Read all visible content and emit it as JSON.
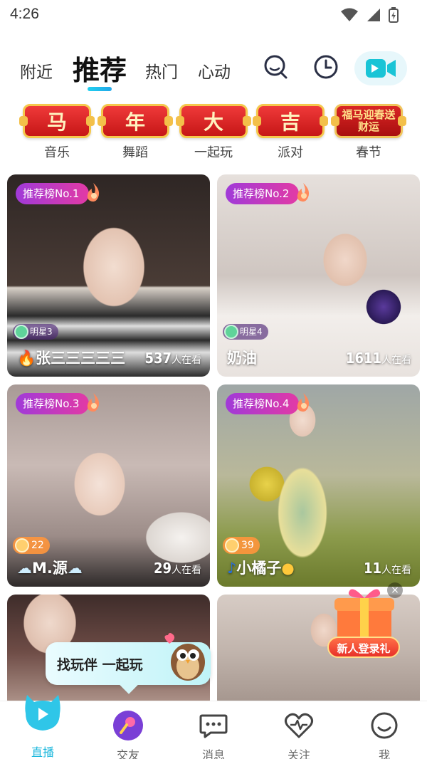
{
  "status_bar": {
    "time": "4:26"
  },
  "top_nav": {
    "tabs": [
      {
        "label": "附近",
        "active": false
      },
      {
        "label": "推荐",
        "active": true
      },
      {
        "label": "热门",
        "active": false
      },
      {
        "label": "心动",
        "active": false
      }
    ],
    "icons": [
      "search-icon",
      "history-clock-icon",
      "live-video-icon"
    ]
  },
  "categories": [
    {
      "badge": "马",
      "label": "音乐"
    },
    {
      "badge": "年",
      "label": "舞蹈"
    },
    {
      "badge": "大",
      "label": "一起玩"
    },
    {
      "badge": "吉",
      "label": "派对"
    },
    {
      "badge": "福马迎春送财运",
      "label": "春节"
    }
  ],
  "cards": [
    {
      "rank": "推荐榜No.1",
      "badge_type": "star",
      "badge_text": "明星3",
      "name": "张三三三三三",
      "viewers": "537",
      "viewer_suffix": "人在看",
      "bg": "#3a2f2c"
    },
    {
      "rank": "推荐榜No.2",
      "badge_type": "star",
      "badge_text": "明星4",
      "name": "奶油",
      "viewers": "1611",
      "viewer_suffix": "人在看",
      "bg": "#d9cfcb"
    },
    {
      "rank": "推荐榜No.3",
      "badge_type": "level",
      "badge_text": "22",
      "name": "M.源",
      "viewers": "29",
      "viewer_suffix": "人在看",
      "bg": "#b7a8a4"
    },
    {
      "rank": "推荐榜No.4",
      "badge_type": "level",
      "badge_text": "39",
      "name": "小橘子",
      "viewers": "11",
      "viewer_suffix": "人在看",
      "bg": "#8fa06a"
    },
    {
      "rank": "",
      "badge_type": "none",
      "badge_text": "",
      "name": "",
      "viewers": "",
      "viewer_suffix": "",
      "bg": "#6a4a45"
    },
    {
      "rank": "",
      "badge_type": "none",
      "badge_text": "",
      "name": "",
      "viewers": "",
      "viewer_suffix": "",
      "bg": "#c9bfb7"
    }
  ],
  "bubble": {
    "text": "找玩伴 一起玩"
  },
  "gift": {
    "label": "新人登录礼",
    "close": "×"
  },
  "bottom_nav": [
    {
      "label": "直播",
      "active": true,
      "icon": "live-home-icon"
    },
    {
      "label": "交友",
      "active": false,
      "icon": "mic-icon"
    },
    {
      "label": "消息",
      "active": false,
      "icon": "message-icon"
    },
    {
      "label": "关注",
      "active": false,
      "icon": "heart-pulse-icon"
    },
    {
      "label": "我",
      "active": false,
      "icon": "smile-icon"
    }
  ]
}
